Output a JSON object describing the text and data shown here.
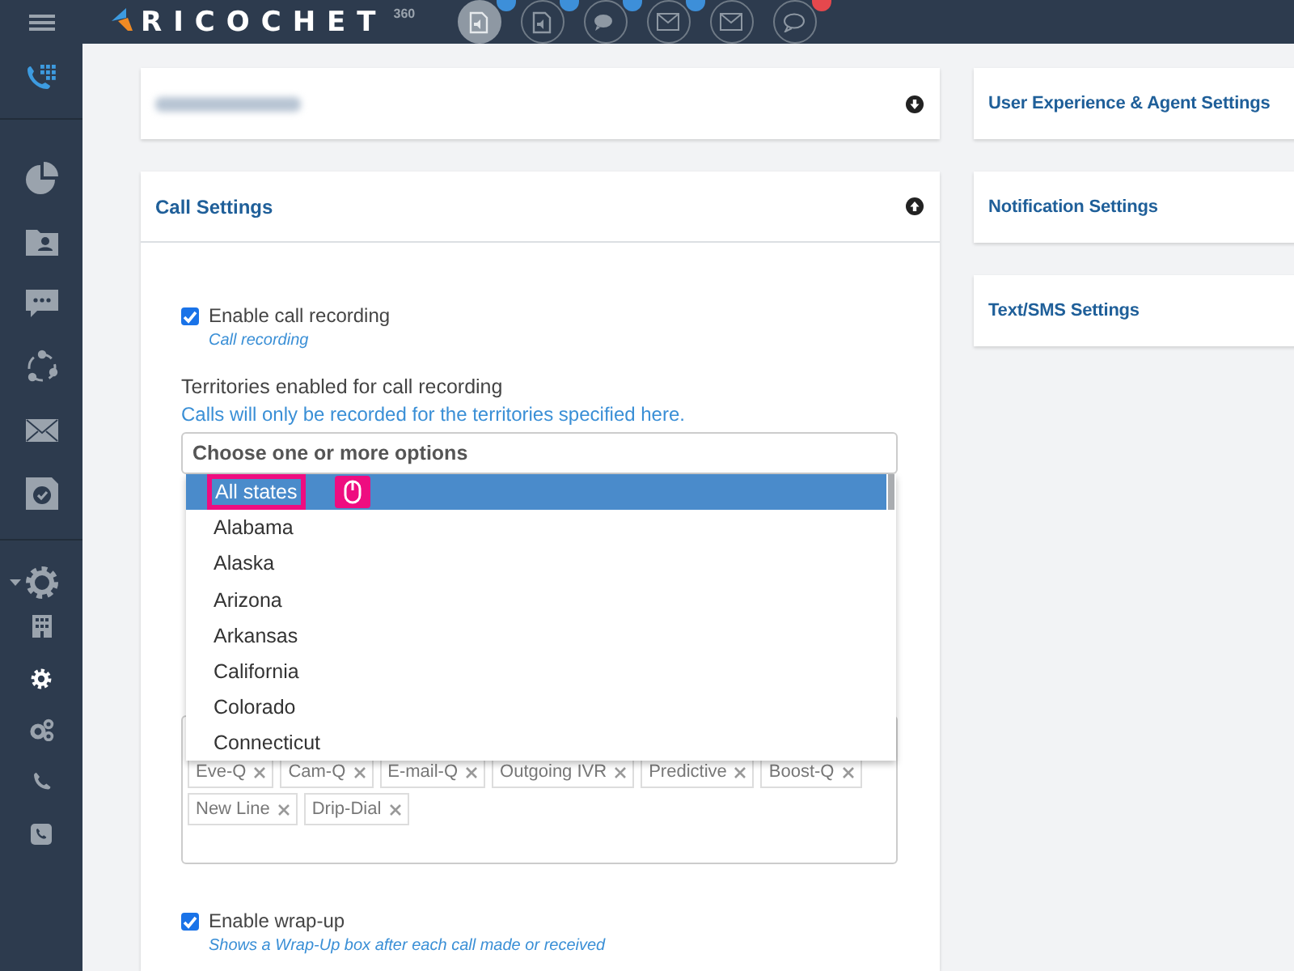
{
  "header": {
    "logo_text": "RICOCHET",
    "logo_superscript": "360",
    "toolbar": [
      {
        "kind": "document",
        "selected": true,
        "color": "#3d8fd9"
      },
      {
        "kind": "document",
        "selected": false,
        "color": "#3d8fd9"
      },
      {
        "kind": "chat",
        "selected": false,
        "color": "#3d8fd9"
      },
      {
        "kind": "mail",
        "selected": false,
        "color": "#3d8fd9"
      },
      {
        "kind": "mail",
        "selected": false
      },
      {
        "kind": "speech",
        "selected": false,
        "color": "#e5484d"
      }
    ]
  },
  "sidebar": {
    "items": [
      {
        "kind": "pie",
        "selected": false
      },
      {
        "kind": "contact",
        "selected": false
      },
      {
        "kind": "chat",
        "selected": false
      },
      {
        "kind": "network",
        "selected": false
      },
      {
        "kind": "mail",
        "selected": false
      },
      {
        "kind": "check",
        "selected": false
      },
      {
        "kind": "gear",
        "selected": false,
        "expanded": true
      },
      {
        "kind": "building",
        "selected": false
      },
      {
        "kind": "gear-small",
        "selected": true
      },
      {
        "kind": "gears",
        "selected": false
      },
      {
        "kind": "phone",
        "selected": false
      },
      {
        "kind": "phone-square",
        "selected": false
      }
    ]
  },
  "left_panels": [
    {
      "kind": "blurred",
      "expanded": false
    },
    {
      "kind": "call_settings",
      "title": "Call Settings",
      "expanded": true
    }
  ],
  "call_settings": {
    "recording": {
      "label": "Enable call recording",
      "hint": "Call recording",
      "checked": true
    },
    "territories": {
      "label": "Territories enabled for call recording",
      "hint": "Calls will only be recorded for the territories specified here.",
      "placeholder": "Choose one or more options",
      "expanded": true,
      "options": [
        {
          "label": "All states",
          "selected": true
        },
        {
          "label": "Alabama",
          "selected": false
        },
        {
          "label": "Alaska",
          "selected": false
        },
        {
          "label": "Arizona",
          "selected": false
        },
        {
          "label": "Arkansas",
          "selected": false
        },
        {
          "label": "California",
          "selected": false
        },
        {
          "label": "Colorado",
          "selected": false
        },
        {
          "label": "Connecticut",
          "selected": false
        }
      ]
    },
    "tags": [
      "Eve-Q",
      "Cam-Q",
      "E-mail-Q",
      "Outgoing IVR",
      "Predictive",
      "Boost-Q",
      "New Line",
      "Drip-Dial"
    ],
    "wrapup": {
      "label": "Enable wrap-up",
      "hint": "Shows a Wrap-Up box after each call made or received",
      "checked": true
    }
  },
  "right_panels": [
    {
      "title": "User Experience & Agent Settings"
    },
    {
      "title": "Notification Settings"
    },
    {
      "title": "Text/SMS Settings"
    }
  ]
}
